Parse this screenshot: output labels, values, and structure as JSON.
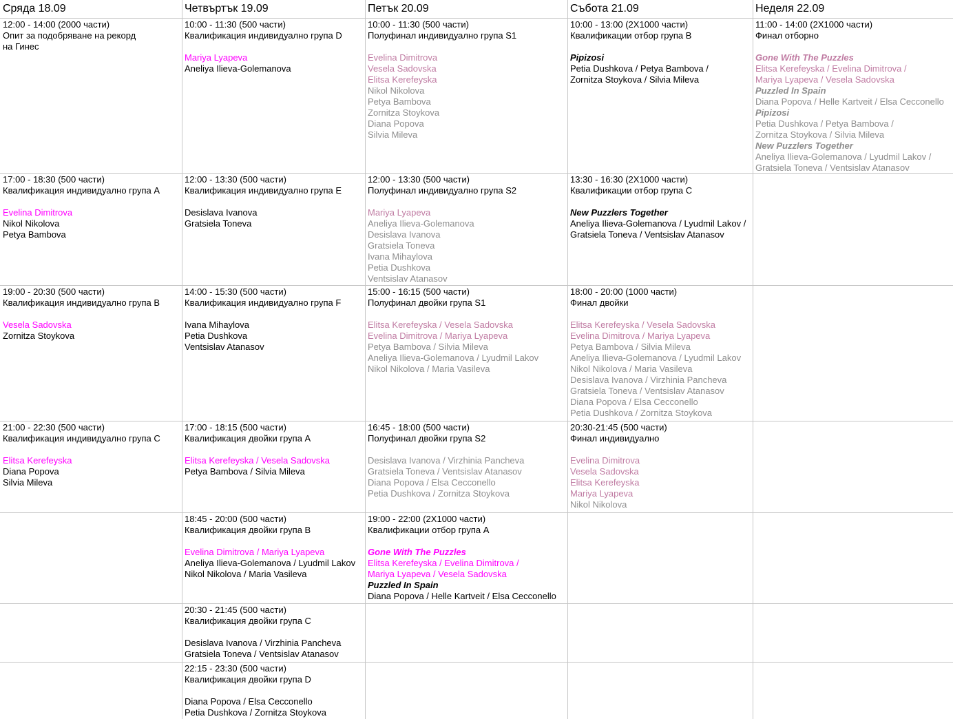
{
  "colors": {
    "qualified": "#ff00ff",
    "finalist": "#c07ca3",
    "grey": "#8e8e8e",
    "grid": "#c6c6c6"
  },
  "days": [
    "Сряда 18.09",
    "Четвъртък 19.09",
    "Петък 20.09",
    "Събота 21.09",
    "Неделя 22.09"
  ],
  "cells": [
    [
      [
        {
          "t": "12:00 - 14:00 (2000 части)",
          "s": "t"
        },
        {
          "t": "Опит за подобряване на рекорд",
          "s": "t"
        },
        {
          "t": "на Гинес",
          "s": "t"
        }
      ],
      [
        {
          "t": "17:00 - 18:30 (500 части)",
          "s": "t"
        },
        {
          "t": "Квалификация индивидуално група A",
          "s": "t"
        },
        {
          "t": ""
        },
        {
          "t": "Evelina Dimitrova",
          "s": "q"
        },
        {
          "t": "Nikol Nikolova"
        },
        {
          "t": "Petya Bambova"
        }
      ],
      [
        {
          "t": "19:00 - 20:30 (500 части)",
          "s": "t"
        },
        {
          "t": "Квалификация индивидуално група B",
          "s": "t"
        },
        {
          "t": ""
        },
        {
          "t": "Vesela Sadovska",
          "s": "q"
        },
        {
          "t": "Zornitza Stoykova"
        }
      ],
      [
        {
          "t": "21:00 - 22:30 (500 части)",
          "s": "t"
        },
        {
          "t": "Квалификация индивидуално група C",
          "s": "t"
        },
        {
          "t": ""
        },
        {
          "t": "Elitsa Kerefeyska",
          "s": "q"
        },
        {
          "t": "Diana Popova"
        },
        {
          "t": "Silvia Mileva"
        }
      ],
      [],
      [],
      []
    ],
    [
      [
        {
          "t": "10:00 - 11:30 (500 части)",
          "s": "t"
        },
        {
          "t": "Квалификация индивидуално група D",
          "s": "t"
        },
        {
          "t": ""
        },
        {
          "t": "Mariya Lyapeva",
          "s": "q"
        },
        {
          "t": "Aneliya Ilieva-Golemanova"
        }
      ],
      [
        {
          "t": "12:00 - 13:30 (500 части)",
          "s": "t"
        },
        {
          "t": "Квалификация индивидуално група E",
          "s": "t"
        },
        {
          "t": ""
        },
        {
          "t": "Desislava Ivanova"
        },
        {
          "t": "Gratsiela Toneva"
        }
      ],
      [
        {
          "t": "14:00 - 15:30 (500 части)",
          "s": "t"
        },
        {
          "t": "Квалификация индивидуално група F",
          "s": "t"
        },
        {
          "t": ""
        },
        {
          "t": "Ivana Mihaylova"
        },
        {
          "t": "Petia Dushkova"
        },
        {
          "t": "Ventsislav Atanasov"
        }
      ],
      [
        {
          "t": "17:00 - 18:15 (500 части)",
          "s": "t"
        },
        {
          "t": "Квалификация двойки група A",
          "s": "t"
        },
        {
          "t": ""
        },
        {
          "t": "Elitsa Kerefeyska / Vesela Sadovska",
          "s": "q"
        },
        {
          "t": "Petya Bambova / Silvia Mileva"
        }
      ],
      [
        {
          "t": "18:45 - 20:00 (500 части)",
          "s": "t"
        },
        {
          "t": "Квалификация двойки група B",
          "s": "t"
        },
        {
          "t": ""
        },
        {
          "t": "Evelina Dimitrova / Mariya Lyapeva",
          "s": "q"
        },
        {
          "t": "Aneliya Ilieva-Golemanova / Lyudmil Lakov"
        },
        {
          "t": "Nikol Nikolova / Maria Vasileva"
        }
      ],
      [
        {
          "t": "20:30 - 21:45 (500 части)",
          "s": "t"
        },
        {
          "t": "Квалификация двойки група C",
          "s": "t"
        },
        {
          "t": ""
        },
        {
          "t": "Desislava Ivanova / Virzhinia Pancheva"
        },
        {
          "t": "Gratsiela Toneva / Ventsislav Atanasov"
        }
      ],
      [
        {
          "t": "22:15 - 23:30 (500 части)",
          "s": "t"
        },
        {
          "t": "Квалификация двойки група D",
          "s": "t"
        },
        {
          "t": ""
        },
        {
          "t": "Diana Popova / Elsa Cecconello"
        },
        {
          "t": "Petia Dushkova / Zornitza Stoykova"
        }
      ]
    ],
    [
      [
        {
          "t": "10:00 - 11:30 (500 части)",
          "s": "t"
        },
        {
          "t": "Полуфинал индивидуално група S1",
          "s": "t"
        },
        {
          "t": ""
        },
        {
          "t": "Evelina Dimitrova",
          "s": "f"
        },
        {
          "t": "Vesela Sadovska",
          "s": "f"
        },
        {
          "t": "Elitsa Kerefeyska",
          "s": "f"
        },
        {
          "t": "Nikol Nikolova",
          "s": "g"
        },
        {
          "t": "Petya Bambova",
          "s": "g"
        },
        {
          "t": "Zornitza Stoykova",
          "s": "g"
        },
        {
          "t": "Diana Popova",
          "s": "g"
        },
        {
          "t": "Silvia Mileva",
          "s": "g"
        }
      ],
      [
        {
          "t": "12:00 - 13:30 (500 части)",
          "s": "t"
        },
        {
          "t": "Полуфинал индивидуално група S2",
          "s": "t"
        },
        {
          "t": ""
        },
        {
          "t": "Mariya Lyapeva",
          "s": "f"
        },
        {
          "t": "Aneliya Ilieva-Golemanova",
          "s": "g"
        },
        {
          "t": "Desislava Ivanova",
          "s": "g"
        },
        {
          "t": "Gratsiela Toneva",
          "s": "g"
        },
        {
          "t": "Ivana Mihaylova",
          "s": "g"
        },
        {
          "t": "Petia Dushkova",
          "s": "g"
        },
        {
          "t": "Ventsislav Atanasov",
          "s": "g"
        }
      ],
      [
        {
          "t": "15:00 - 16:15 (500 части)",
          "s": "t"
        },
        {
          "t": "Полуфинал двойки група S1",
          "s": "t"
        },
        {
          "t": ""
        },
        {
          "t": "Elitsa Kerefeyska / Vesela Sadovska",
          "s": "f"
        },
        {
          "t": "Evelina Dimitrova / Mariya Lyapeva",
          "s": "f"
        },
        {
          "t": "Petya Bambova / Silvia Mileva",
          "s": "g"
        },
        {
          "t": "Aneliya Ilieva-Golemanova / Lyudmil Lakov",
          "s": "g"
        },
        {
          "t": "Nikol Nikolova / Maria Vasileva",
          "s": "g"
        }
      ],
      [
        {
          "t": "16:45 - 18:00 (500 части)",
          "s": "t"
        },
        {
          "t": "Полуфинал двойки група S2",
          "s": "t"
        },
        {
          "t": ""
        },
        {
          "t": "Desislava Ivanova / Virzhinia Pancheva",
          "s": "g"
        },
        {
          "t": "Gratsiela Toneva / Ventsislav Atanasov",
          "s": "g"
        },
        {
          "t": "Diana Popova / Elsa Cecconello",
          "s": "g"
        },
        {
          "t": "Petia Dushkova / Zornitza Stoykova",
          "s": "g"
        }
      ],
      [
        {
          "t": "19:00 - 22:00 (2X1000 части)",
          "s": "t"
        },
        {
          "t": "Квалификации отбор група A",
          "s": "t"
        },
        {
          "t": ""
        },
        {
          "t": "Gone With The Puzzles",
          "s": "qt"
        },
        {
          "t": "Elitsa Kerefeyska / Evelina Dimitrova /",
          "s": "q"
        },
        {
          "t": "Mariya Lyapeva / Vesela Sadovska",
          "s": "q"
        },
        {
          "t": "Puzzled In Spain",
          "s": "tb"
        },
        {
          "t": "Diana Popova / Helle Kartveit / Elsa Cecconello"
        }
      ],
      [],
      []
    ],
    [
      [
        {
          "t": "10:00 - 13:00 (2X1000 части)",
          "s": "t"
        },
        {
          "t": "Квалификации отбор група B",
          "s": "t"
        },
        {
          "t": ""
        },
        {
          "t": "Pipizosi",
          "s": "tb"
        },
        {
          "t": "Petia Dushkova / Petya Bambova /"
        },
        {
          "t": "Zornitza Stoykova / Silvia Mileva"
        }
      ],
      [
        {
          "t": "13:30 - 16:30 (2X1000 части)",
          "s": "t"
        },
        {
          "t": "Квалификации отбор група C",
          "s": "t"
        },
        {
          "t": ""
        },
        {
          "t": "New Puzzlers Together",
          "s": "tb"
        },
        {
          "t": "Aneliya Ilieva-Golemanova / Lyudmil Lakov /"
        },
        {
          "t": "Gratsiela Toneva / Ventsislav Atanasov"
        }
      ],
      [
        {
          "t": "18:00 - 20:00 (1000 части)",
          "s": "t"
        },
        {
          "t": "Финал двойки",
          "s": "t"
        },
        {
          "t": ""
        },
        {
          "t": "Elitsa Kerefeyska / Vesela Sadovska",
          "s": "f"
        },
        {
          "t": "Evelina Dimitrova / Mariya Lyapeva",
          "s": "f"
        },
        {
          "t": "Petya Bambova / Silvia Mileva",
          "s": "g"
        },
        {
          "t": "Aneliya Ilieva-Golemanova / Lyudmil Lakov",
          "s": "g"
        },
        {
          "t": "Nikol Nikolova / Maria Vasileva",
          "s": "g"
        },
        {
          "t": "Desislava Ivanova / Virzhinia Pancheva",
          "s": "g"
        },
        {
          "t": "Gratsiela Toneva / Ventsislav Atanasov",
          "s": "g"
        },
        {
          "t": "Diana Popova / Elsa Cecconello",
          "s": "g"
        },
        {
          "t": "Petia Dushkova / Zornitza Stoykova",
          "s": "g"
        }
      ],
      [
        {
          "t": "20:30-21:45 (500 части)",
          "s": "t"
        },
        {
          "t": "Финал индивидуално",
          "s": "t"
        },
        {
          "t": ""
        },
        {
          "t": "Evelina Dimitrova",
          "s": "f"
        },
        {
          "t": "Vesela Sadovska",
          "s": "f"
        },
        {
          "t": "Elitsa Kerefeyska",
          "s": "f"
        },
        {
          "t": "Mariya Lyapeva",
          "s": "f"
        },
        {
          "t": "Nikol Nikolova",
          "s": "g"
        }
      ],
      [],
      [],
      []
    ],
    [
      [
        {
          "t": "11:00 - 14:00 (2X1000 части)",
          "s": "t"
        },
        {
          "t": "Финал отборно",
          "s": "t"
        },
        {
          "t": ""
        },
        {
          "t": "Gone With The Puzzles",
          "s": "ft"
        },
        {
          "t": "Elitsa Kerefeyska / Evelina Dimitrova /",
          "s": "f"
        },
        {
          "t": "Mariya Lyapeva / Vesela Sadovska",
          "s": "f"
        },
        {
          "t": "Puzzled In Spain",
          "s": "gt"
        },
        {
          "t": "Diana Popova / Helle Kartveit / Elsa Cecconello",
          "s": "g"
        },
        {
          "t": "Pipizosi",
          "s": "gt"
        },
        {
          "t": "Petia Dushkova / Petya Bambova /",
          "s": "g"
        },
        {
          "t": "Zornitza Stoykova / Silvia Mileva",
          "s": "g"
        },
        {
          "t": "New Puzzlers Together",
          "s": "gt"
        },
        {
          "t": "Aneliya Ilieva-Golemanova / Lyudmil Lakov /",
          "s": "g"
        },
        {
          "t": "Gratsiela Toneva / Ventsislav Atanasov",
          "s": "g"
        }
      ],
      [],
      [],
      [],
      [],
      [],
      []
    ]
  ]
}
